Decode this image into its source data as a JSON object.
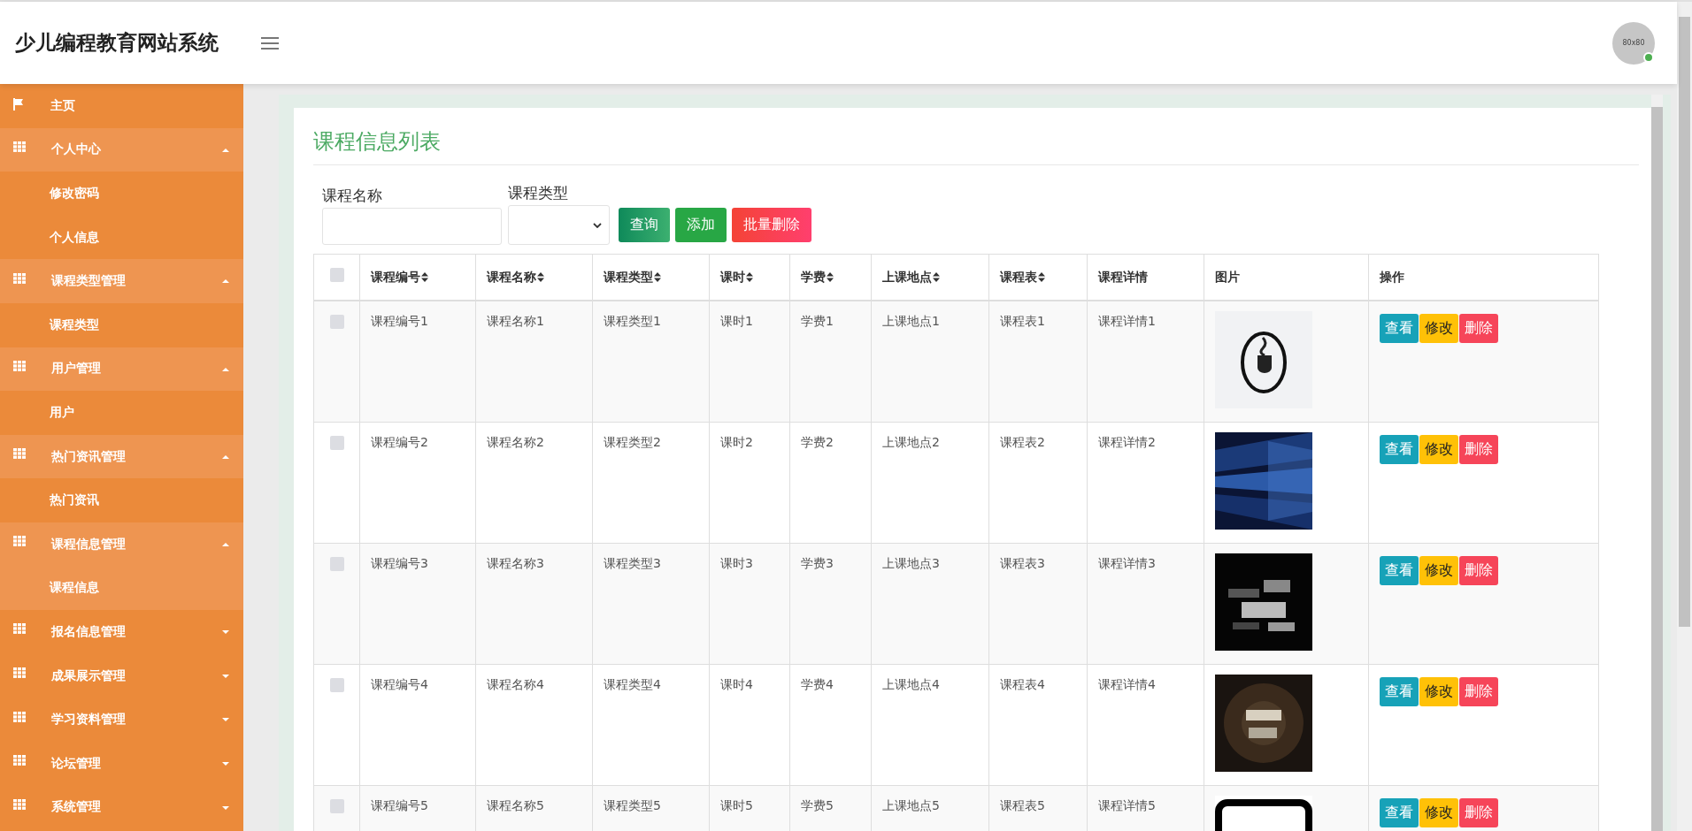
{
  "header": {
    "title": "少儿编程教育网站系统",
    "avatar": {
      "label": "80x80",
      "online": true
    }
  },
  "sidebar": {
    "items": [
      {
        "kind": "link",
        "label": "主页",
        "selected": false
      },
      {
        "kind": "group",
        "label": "个人中心",
        "expanded": true,
        "children": [
          {
            "label": "修改密码",
            "selected": false
          },
          {
            "label": "个人信息",
            "selected": false
          }
        ]
      },
      {
        "kind": "group",
        "label": "课程类型管理",
        "expanded": true,
        "children": [
          {
            "label": "课程类型",
            "selected": false
          }
        ]
      },
      {
        "kind": "group",
        "label": "用户管理",
        "expanded": true,
        "children": [
          {
            "label": "用户",
            "selected": false
          }
        ]
      },
      {
        "kind": "group",
        "label": "热门资讯管理",
        "expanded": true,
        "children": [
          {
            "label": "热门资讯",
            "selected": false
          }
        ]
      },
      {
        "kind": "group",
        "label": "课程信息管理",
        "expanded": true,
        "children": [
          {
            "label": "课程信息",
            "selected": true
          }
        ]
      },
      {
        "kind": "group",
        "label": "报名信息管理",
        "expanded": false
      },
      {
        "kind": "group",
        "label": "成果展示管理",
        "expanded": false
      },
      {
        "kind": "group",
        "label": "学习资料管理",
        "expanded": false
      },
      {
        "kind": "group",
        "label": "论坛管理",
        "expanded": false
      },
      {
        "kind": "group",
        "label": "系统管理",
        "expanded": false
      }
    ]
  },
  "page": {
    "title": "课程信息列表",
    "filters": [
      {
        "kind": "text",
        "label": "课程名称"
      },
      {
        "kind": "select",
        "label": "课程类型"
      }
    ],
    "buttons": [
      {
        "kind": "search",
        "label": "查询"
      },
      {
        "kind": "add",
        "label": "添加"
      },
      {
        "kind": "batch-delete",
        "label": "批量删除"
      }
    ],
    "table": {
      "select_all": {
        "checked": false
      },
      "columns": [
        {
          "label": "课程编号",
          "sortable": true
        },
        {
          "label": "课程名称",
          "sortable": true
        },
        {
          "label": "课程类型",
          "sortable": true
        },
        {
          "label": "课时",
          "sortable": true
        },
        {
          "label": "学费",
          "sortable": true
        },
        {
          "label": "上课地点",
          "sortable": true
        },
        {
          "label": "课程表",
          "sortable": true
        },
        {
          "label": "课程详情",
          "sortable": false
        },
        {
          "label": "图片",
          "sortable": false
        },
        {
          "label": "操作",
          "sortable": false
        }
      ],
      "rows": [
        {
          "checked": false,
          "cells": [
            "课程编号1",
            "课程名称1",
            "课程类型1",
            "课时1",
            "学费1",
            "上课地点1",
            "课程表1",
            "课程详情1"
          ],
          "actions": [
            {
              "kind": "view",
              "label": "查看"
            },
            {
              "kind": "edit",
              "label": "修改"
            },
            {
              "kind": "delete",
              "label": "删除"
            }
          ]
        },
        {
          "checked": false,
          "cells": [
            "课程编号2",
            "课程名称2",
            "课程类型2",
            "课时2",
            "学费2",
            "上课地点2",
            "课程表2",
            "课程详情2"
          ],
          "actions": [
            {
              "kind": "view",
              "label": "查看"
            },
            {
              "kind": "edit",
              "label": "修改"
            },
            {
              "kind": "delete",
              "label": "删除"
            }
          ]
        },
        {
          "checked": false,
          "cells": [
            "课程编号3",
            "课程名称3",
            "课程类型3",
            "课时3",
            "学费3",
            "上课地点3",
            "课程表3",
            "课程详情3"
          ],
          "actions": [
            {
              "kind": "view",
              "label": "查看"
            },
            {
              "kind": "edit",
              "label": "修改"
            },
            {
              "kind": "delete",
              "label": "删除"
            }
          ]
        },
        {
          "checked": false,
          "cells": [
            "课程编号4",
            "课程名称4",
            "课程类型4",
            "课时4",
            "学费4",
            "上课地点4",
            "课程表4",
            "课程详情4"
          ],
          "actions": [
            {
              "kind": "view",
              "label": "查看"
            },
            {
              "kind": "edit",
              "label": "修改"
            },
            {
              "kind": "delete",
              "label": "删除"
            }
          ]
        },
        {
          "checked": false,
          "cells": [
            "课程编号5",
            "课程名称5",
            "课程类型5",
            "课时5",
            "学费5",
            "上课地点5",
            "课程表5",
            "课程详情5"
          ],
          "actions": [
            {
              "kind": "view",
              "label": "查看"
            },
            {
              "kind": "edit",
              "label": "修改"
            },
            {
              "kind": "delete",
              "label": "删除"
            }
          ]
        }
      ]
    }
  }
}
